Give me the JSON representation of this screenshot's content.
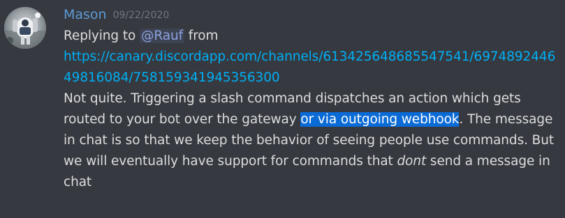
{
  "author": {
    "username": "Mason",
    "timestamp": "09/22/2020",
    "username_color": "#5d9ad7"
  },
  "message": {
    "reply_prefix": "Replying to ",
    "mention": "@Rauf",
    "reply_from": " from",
    "link": "https://canary.discordapp.com/channels/613425648685547541/697489244649816084/758159341945356300",
    "text_part1": "Not quite. Triggering a slash command dispatches an action which gets routed to your bot over the gateway ",
    "text_highlighted": "or via outgoing webhook",
    "text_part2": ". The message in chat is so that we keep the behavior of seeing people use commands. But we will eventually have support for commands that ",
    "text_emphasis": "dont",
    "text_part3": " send a message in chat"
  },
  "colors": {
    "background": "#36393f",
    "link": "#00aff4",
    "mention": "#8ea1e1",
    "selection": "#0a6bd6",
    "timestamp": "#72767d"
  }
}
